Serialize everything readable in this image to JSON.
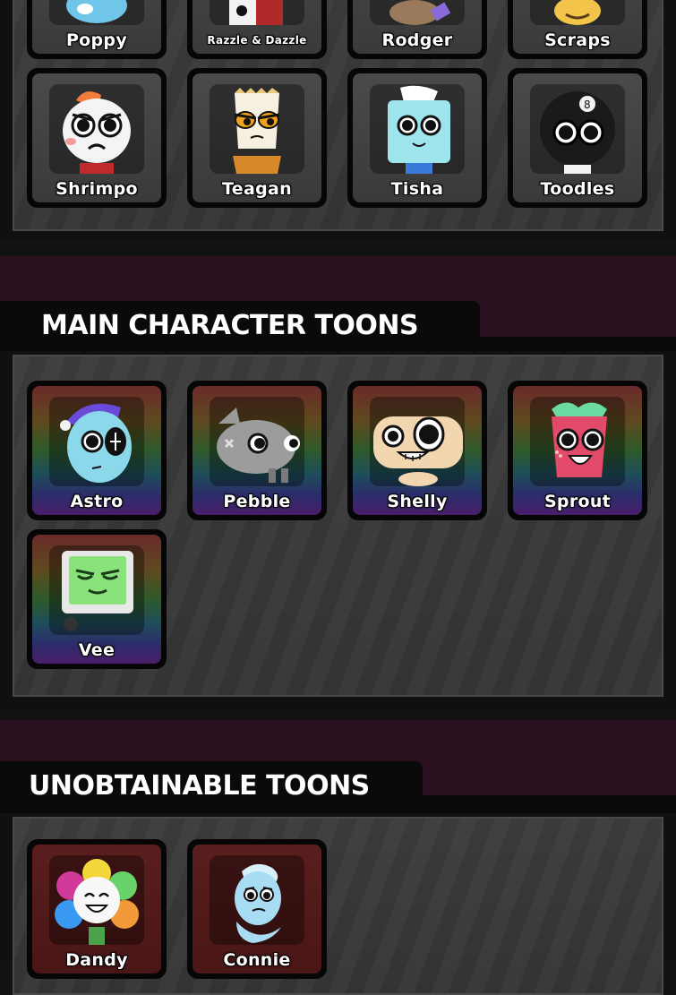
{
  "sections": {
    "top": {
      "cards": [
        {
          "name": "Poppy"
        },
        {
          "name": "Razzle & Dazzle"
        },
        {
          "name": "Rodger"
        },
        {
          "name": "Scraps"
        },
        {
          "name": "Shrimpo"
        },
        {
          "name": "Teagan"
        },
        {
          "name": "Tisha"
        },
        {
          "name": "Toodles"
        }
      ]
    },
    "main": {
      "title": "MAIN CHARACTER TOONS",
      "cards": [
        {
          "name": "Astro"
        },
        {
          "name": "Pebble"
        },
        {
          "name": "Shelly"
        },
        {
          "name": "Sprout"
        },
        {
          "name": "Vee"
        }
      ]
    },
    "unobtainable": {
      "title": "UNOBTAINABLE TOONS",
      "cards": [
        {
          "name": "Dandy"
        },
        {
          "name": "Connie"
        }
      ]
    }
  },
  "colors": {
    "band": "#2b1120",
    "header_bg": "#0a0a0a",
    "panel": "#3a3a3a"
  }
}
